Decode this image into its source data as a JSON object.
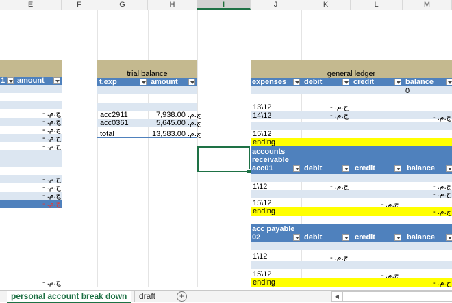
{
  "columns": [
    "E",
    "F",
    "G",
    "H",
    "I",
    "J",
    "K",
    "L",
    "M"
  ],
  "left_table": {
    "header_fragment": "1",
    "amount_header": "amount",
    "value": "-",
    "currency": "ج.م.‏",
    "bottom_value": "-"
  },
  "trial_balance": {
    "title": "trial balance",
    "col1": "t.exp",
    "col2": "amount",
    "rows": [
      {
        "account": "acc2911",
        "amount": "7,938.00"
      },
      {
        "account": "acc0361",
        "amount": "5,645.00"
      }
    ],
    "total_label": "total",
    "total_amount": "13,583.00",
    "currency": "ج.م.‏"
  },
  "general_ledger": {
    "title": "general ledger",
    "headers": [
      "expenses",
      "debit",
      "credit",
      "balance"
    ],
    "balance_note": "0",
    "rows": [
      "13\\12",
      "14\\12"
    ],
    "row2_label": "15\\12",
    "ending": "ending",
    "dash": "-"
  },
  "accounts_receivable": {
    "title_line1": "accounts",
    "title_line2": "receivable",
    "title_line3": "acc01",
    "headers": [
      "debit",
      "credit",
      "balance"
    ],
    "row1": "1\\12",
    "row2": "15\\12",
    "ending": "ending",
    "dash": "-"
  },
  "acc_payable": {
    "title_line1": "acc payable",
    "title_line2": "02",
    "headers": [
      "debit",
      "credit",
      "balance"
    ],
    "row1": "1\\12",
    "row2": "15\\12",
    "ending": "ending",
    "dash": "-"
  },
  "sheet_tabs": {
    "active": "personal account break down",
    "other": "draft",
    "add": "+"
  },
  "colors": {
    "header_blue": "#4f81bd",
    "band_blue": "#dce6f1",
    "title_tan": "#c4b98f",
    "ending_yellow": "#ffff00",
    "tab_green": "#1e7145"
  }
}
